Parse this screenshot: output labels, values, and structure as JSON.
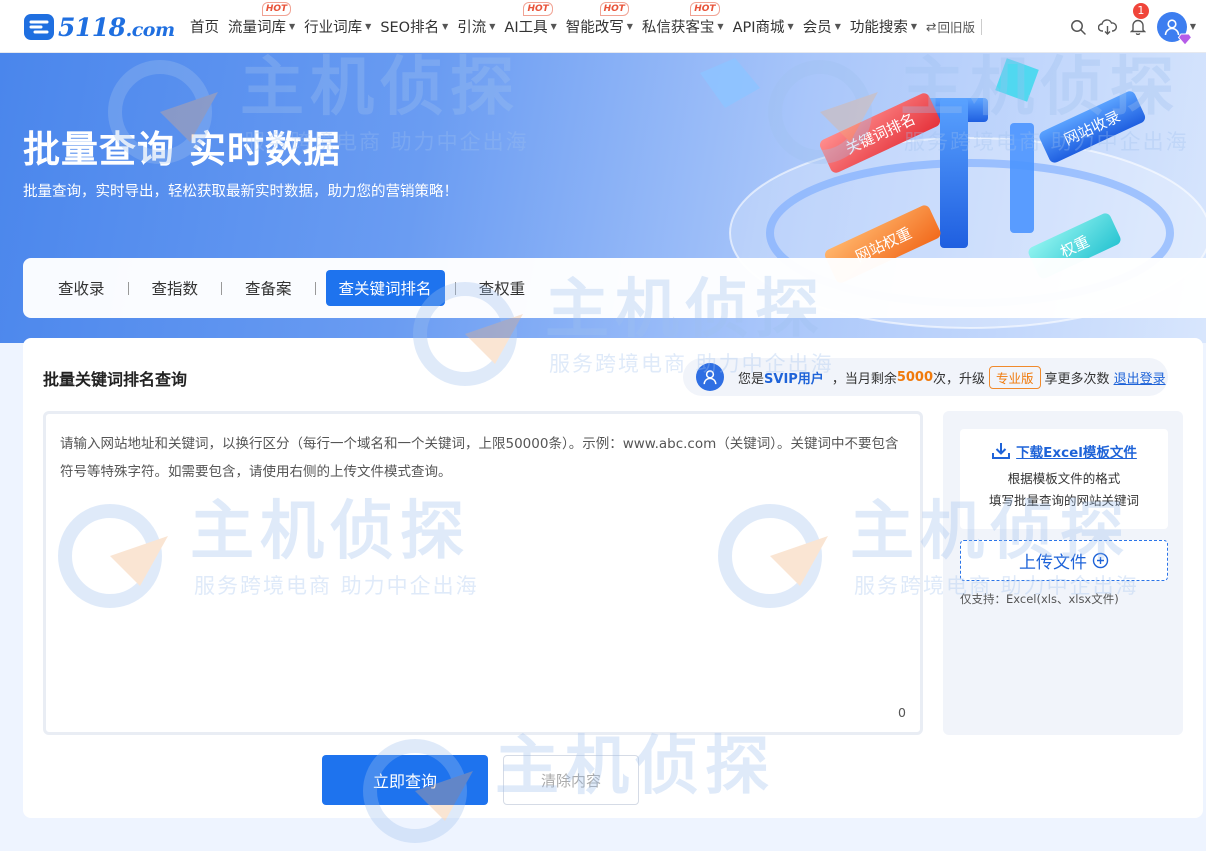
{
  "site": {
    "logo_text": "5118",
    "logo_suffix": ".com",
    "brand_color": "#1f6fe0"
  },
  "nav": {
    "items": [
      {
        "label": "首页",
        "caret": false,
        "hot": false
      },
      {
        "label": "流量词库",
        "caret": true,
        "hot": true
      },
      {
        "label": "行业词库",
        "caret": true,
        "hot": false
      },
      {
        "label": "SEO排名",
        "caret": true,
        "hot": false
      },
      {
        "label": "引流",
        "caret": true,
        "hot": false
      },
      {
        "label": "AI工具",
        "caret": true,
        "hot": true
      },
      {
        "label": "智能改写",
        "caret": true,
        "hot": true
      },
      {
        "label": "私信获客宝",
        "caret": true,
        "hot": true
      },
      {
        "label": "API商城",
        "caret": true,
        "hot": false
      },
      {
        "label": "会员",
        "caret": true,
        "hot": false
      },
      {
        "label": "功能搜索",
        "caret": true,
        "hot": false
      }
    ],
    "hot_label": "HOT",
    "old_version": "回旧版",
    "notification_count": "1",
    "icons": [
      "search-icon",
      "cloud-download-icon",
      "bell-icon",
      "user-avatar-icon"
    ]
  },
  "hero": {
    "title": "批量查询 实时数据",
    "subtitle": "批量查询，实时导出，轻松获取最新实时数据，助力您的营销策略！",
    "art_labels": [
      "关键词排名",
      "网站收录",
      "网站权重",
      "权重"
    ]
  },
  "tabs": {
    "items": [
      "查收录",
      "查指数",
      "查备案",
      "查关键词排名",
      "查权重"
    ],
    "active": "查关键词排名"
  },
  "card": {
    "title": "批量关键词排名查询",
    "user_bar": {
      "prefix": "您是",
      "level": "SVIP用户",
      "remain_prefix": "，当月剩余",
      "remain_count": "5000",
      "remain_suffix": "次，升级",
      "pro_tag": "专业版",
      "more": "享更多次数",
      "logout": "退出登录"
    },
    "editor": {
      "placeholder": "请输入网站地址和关键词，以换行区分（每行一个域名和一个关键词，上限50000条）。示例：www.abc.com（关键词）。关键词中不要包含符号等特殊字符。如需要包含，请使用右侧的上传文件模式查询。",
      "count": "0"
    },
    "side": {
      "download_label": "下载Excel模板文件",
      "download_desc_1": "根据模板文件的格式",
      "download_desc_2": "填写批量查询的网站关键词",
      "upload_label": "上传文件",
      "upload_note": "仅支持：Excel(xls、xlsx文件)"
    },
    "buttons": {
      "query": "立即查询",
      "clear": "清除内容"
    }
  },
  "watermark": {
    "main": "主机侦探",
    "sub": "服务跨境电商 助力中企出海"
  },
  "colors": {
    "accent": "#1e73ee",
    "warning": "#f07a0c",
    "hot": "#e8543a"
  }
}
